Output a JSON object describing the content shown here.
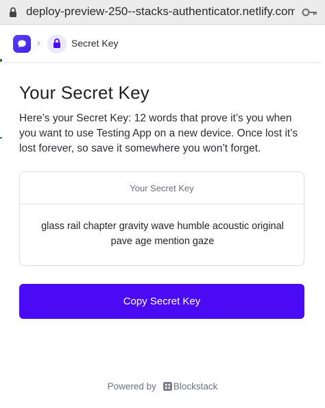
{
  "browser": {
    "url": "deploy-preview-250--stacks-authenticator.netlify.com/a..."
  },
  "header": {
    "logo_icon": "chat-bubble-icon",
    "separator": "›",
    "crumb_icon": "lock-icon",
    "crumb_label": "Secret Key"
  },
  "main": {
    "title": "Your Secret Key",
    "description": "Here’s your Secret Key: 12 words that prove it’s you when you want to use Testing App on a new device. Once lost it’s lost forever, so save it somewhere you won’t forget.",
    "card": {
      "heading": "Your Secret Key",
      "phrase": "glass rail chapter gravity wave humble acoustic original pave age mention gaze"
    },
    "copy_button_label": "Copy Secret Key"
  },
  "footer": {
    "powered_by": "Powered by",
    "brand": "Blockstack",
    "brand_icon": "blockstack-logo-icon"
  },
  "colors": {
    "accent": "#4a0bf4",
    "logo": "#4f31ef",
    "crumb_icon_bg": "#ebe8fb"
  }
}
